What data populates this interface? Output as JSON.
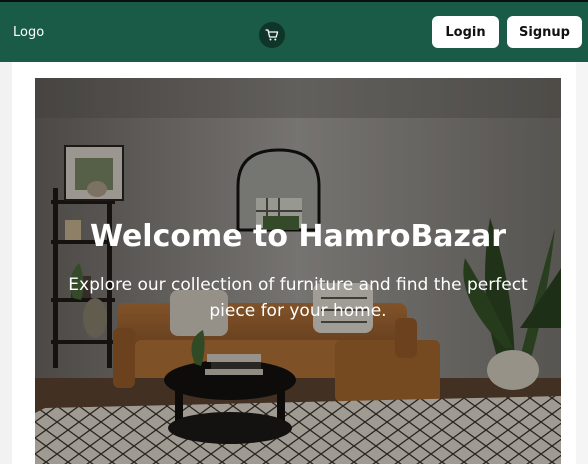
{
  "navbar": {
    "logo": "Logo",
    "cart_icon": "shopping-cart-icon",
    "login_label": "Login",
    "signup_label": "Signup",
    "background_color": "#1a5b47"
  },
  "hero": {
    "title": "Welcome to HamroBazar",
    "subtitle": "Explore our collection of furniture and find the perfect piece for your home."
  }
}
